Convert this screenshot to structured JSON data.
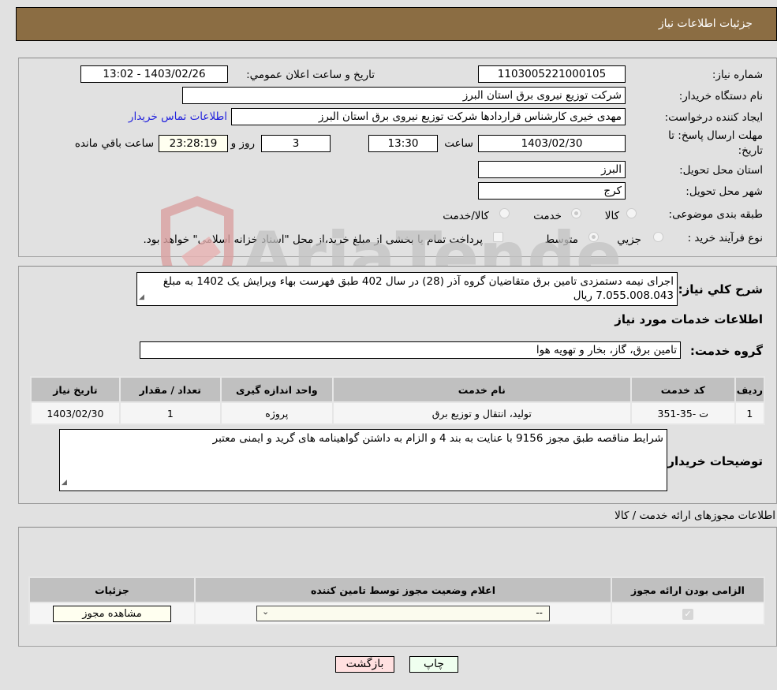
{
  "header": {
    "title": "جزئیات اطلاعات نیاز"
  },
  "info": {
    "need_number_label": "شماره نیاز:",
    "need_number": "1103005221000105",
    "announce_label": "تاریخ و ساعت اعلان عمومي:",
    "announce_value": "1403/02/26 - 13:02",
    "buyer_org_label": "نام دستگاه خریدار:",
    "buyer_org": "شرکت توزیع نیروی برق استان البرز",
    "creator_label": "ایجاد کننده درخواست:",
    "creator": "مهدی خیری کارشناس قراردادها شرکت توزیع نیروی برق استان البرز",
    "contact_link": "اطلاعات تماس خریدار",
    "deadline_label_1": "مهلت ارسال پاسخ: تا",
    "deadline_label_2": "تاریخ:",
    "deadline_date": "1403/02/30",
    "time_label": "ساعت",
    "deadline_time": "13:30",
    "days": "3",
    "days_label": "روز و",
    "remaining": "23:28:19",
    "remaining_label": "ساعت باقي مانده",
    "province_label": "استان محل تحویل:",
    "province": "البرز",
    "city_label": "شهر محل تحویل:",
    "city": "کرج",
    "category_label": "طبقه بندی موضوعی:",
    "category_options": [
      "کالا",
      "خدمت",
      "کالا/خدمت"
    ],
    "category_selected": "خدمت",
    "process_label": "نوع فرآیند خرید :",
    "process_options": [
      "جزيي",
      "متوسط"
    ],
    "process_selected": "متوسط",
    "treasury_note": "پرداخت تمام یا بخشی از مبلغ خرید،از محل \"اسناد خزانه اسلامی\" خواهد بود."
  },
  "description": {
    "label": "شرح کلي نیاز:",
    "text": "اجرای نیمه دستمزدی تامین برق متقاضیان گروه آذر (28) در سال 402 طبق فهرست بهاء ویرایش یک 1402 به مبلغ 7.055.008.043 ریال"
  },
  "services": {
    "section_title": "اطلاعات خدمات مورد نیاز",
    "group_label": "گروه خدمت:",
    "group_value": "تامین برق، گاز، بخار و تهویه هوا",
    "columns": [
      "ردیف",
      "کد خدمت",
      "نام خدمت",
      "واحد اندازه گیری",
      "تعداد / مقدار",
      "تاریخ نیاز"
    ],
    "rows": [
      [
        "1",
        "ت -35-351",
        "تولید، انتقال و توزیع برق",
        "پروژه",
        "1",
        "1403/02/30"
      ]
    ]
  },
  "buyer_notes": {
    "label": "توضیحات خریدار:",
    "text": "شرایط مناقصه طبق مجوز 9156 با عنایت به بند 4 و الزام به داشتن گواهینامه های گرید و ایمنی معتبر"
  },
  "permits": {
    "section_title": "اطلاعات مجوزهای ارائه خدمت / کالا",
    "columns": [
      "الزامی بودن ارائه مجوز",
      "اعلام وضعیت مجوز توسط تامین کننده",
      "جزئیات"
    ],
    "row": {
      "required_checked": true,
      "status_value": "--",
      "details_button": "مشاهده مجوز"
    }
  },
  "footer": {
    "back_button": "بازگشت",
    "print_button": "چاپ"
  },
  "watermark": "AriaTender.neT"
}
